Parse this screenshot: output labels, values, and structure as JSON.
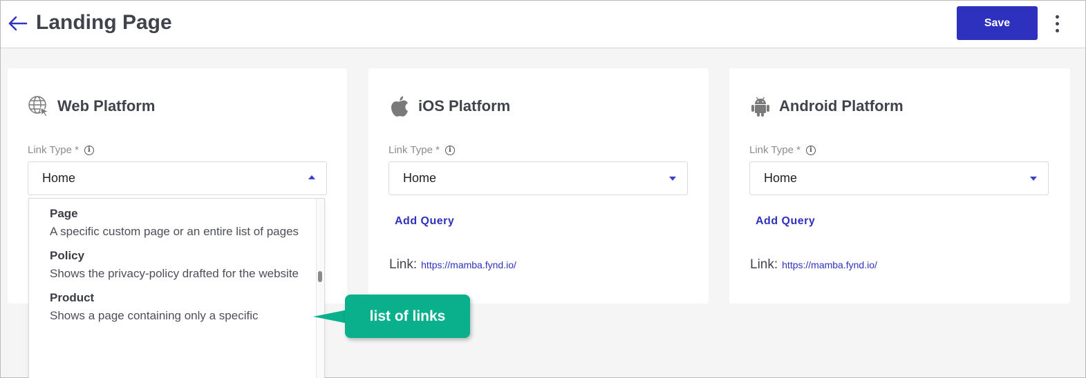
{
  "header": {
    "title": "Landing Page",
    "save_label": "Save"
  },
  "icons": {
    "back": "arrow-left-icon",
    "more": "more-vertical-icon",
    "web": "globe-icon",
    "ios": "apple-icon",
    "android": "android-icon",
    "info": "info-icon"
  },
  "colors": {
    "accent": "#2e31be",
    "callout": "#0aaf8c"
  },
  "cards": {
    "web": {
      "title": "Web Platform",
      "link_type_label": "Link Type *",
      "selected": "Home"
    },
    "ios": {
      "title": "iOS Platform",
      "link_type_label": "Link Type *",
      "selected": "Home",
      "add_query": "Add Query",
      "link_label": "Link:",
      "link_url": "https://mamba.fynd.io/"
    },
    "android": {
      "title": "Android Platform",
      "link_type_label": "Link Type *",
      "selected": "Home",
      "add_query": "Add Query",
      "link_label": "Link:",
      "link_url": "https://mamba.fynd.io/"
    }
  },
  "dropdown": {
    "items": [
      {
        "title": "Page",
        "desc": "A specific custom page or an entire list of pages"
      },
      {
        "title": "Policy",
        "desc": "Shows the privacy-policy drafted for the website"
      },
      {
        "title": "Product",
        "desc": "Shows a page containing only a specific"
      }
    ]
  },
  "callout": {
    "text": "list of links"
  }
}
